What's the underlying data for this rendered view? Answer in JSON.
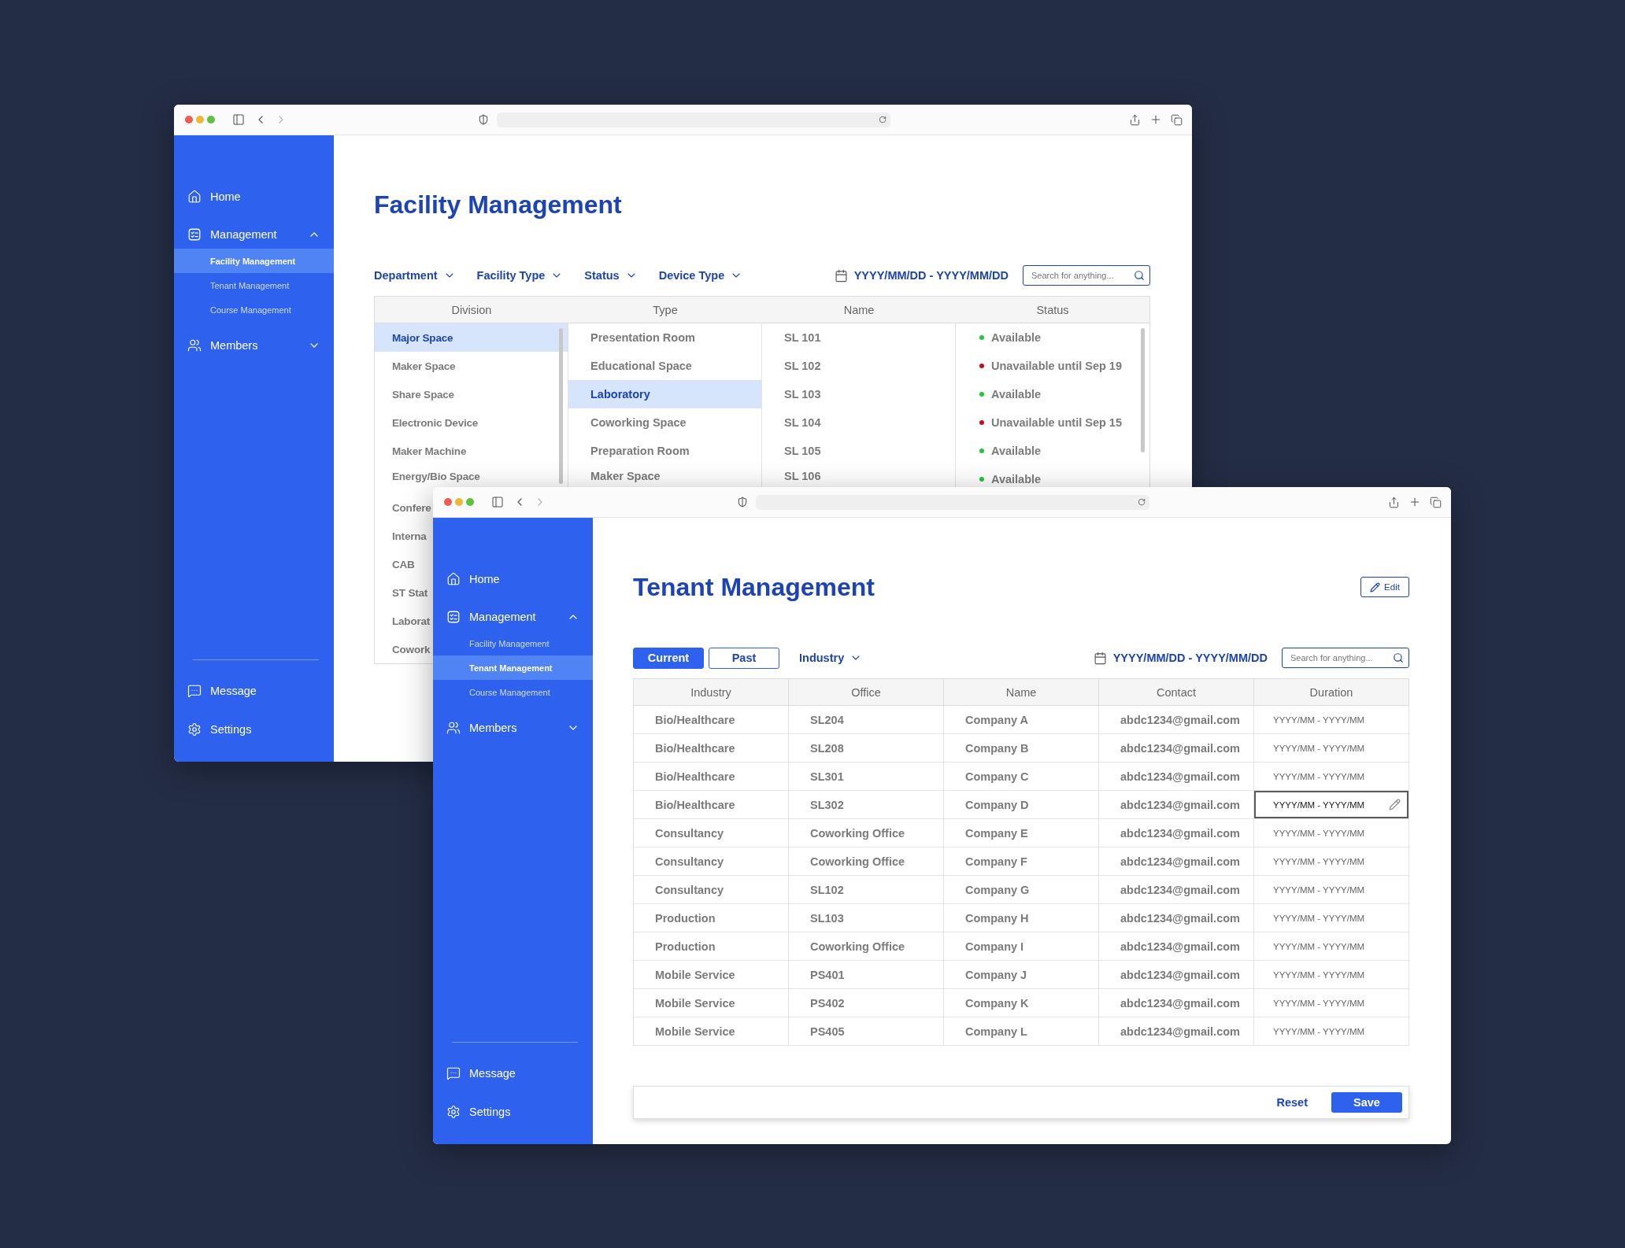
{
  "facility_window": {
    "sidebar": {
      "items": [
        {
          "kind": "home",
          "label": "Home"
        },
        {
          "kind": "management",
          "label": "Management",
          "expanded": true,
          "children": [
            {
              "label": "Facility Management",
              "selected": true
            },
            {
              "label": "Tenant Management",
              "selected": false
            },
            {
              "label": "Course Management",
              "selected": false
            }
          ]
        },
        {
          "kind": "members",
          "label": "Members",
          "expanded": false
        }
      ],
      "bottom_items": [
        {
          "kind": "message",
          "label": "Message"
        },
        {
          "kind": "settings",
          "label": "Settings"
        }
      ]
    },
    "title": "Facility Management",
    "filters": [
      "Department",
      "Facility Type",
      "Status",
      "Device Type"
    ],
    "date_range": "YYYY/MM/DD - YYYY/MM/DD",
    "search": {
      "placeholder": "Search for anything..."
    },
    "table": {
      "columns": [
        "Division",
        "Type",
        "Name",
        "Status"
      ],
      "division": [
        {
          "label": "Major Space",
          "selected": true
        },
        {
          "label": "Maker Space",
          "selected": false
        },
        {
          "label": "Share Space",
          "selected": false
        },
        {
          "label": "Electronic Device",
          "selected": false
        },
        {
          "label": "Maker Machine",
          "selected": false
        },
        {
          "label": "Energy/Bio Space",
          "selected": false
        },
        {
          "label": "Confere",
          "selected": false
        },
        {
          "label": "Interna",
          "selected": false
        },
        {
          "label": "CAB",
          "selected": false
        },
        {
          "label": "ST Stat",
          "selected": false
        },
        {
          "label": "Laborat",
          "selected": false
        },
        {
          "label": "Cowork",
          "selected": false
        }
      ],
      "type": [
        {
          "label": "Presentation Room",
          "selected": false
        },
        {
          "label": "Educational Space",
          "selected": false
        },
        {
          "label": "Laboratory",
          "selected": true
        },
        {
          "label": "Coworking Space",
          "selected": false
        },
        {
          "label": "Preparation Room",
          "selected": false
        },
        {
          "label": "Maker Space",
          "selected": false
        }
      ],
      "name": [
        "SL 101",
        "SL 102",
        "SL 103",
        "SL 104",
        "SL 105",
        "SL 106"
      ],
      "status": [
        {
          "label": "Available",
          "color": "#1fc93a"
        },
        {
          "label": "Unavailable until Sep 19",
          "color": "#c0121a"
        },
        {
          "label": "Available",
          "color": "#1fc93a"
        },
        {
          "label": "Unavailable until Sep 15",
          "color": "#c0121a"
        },
        {
          "label": "Available",
          "color": "#1fc93a"
        },
        {
          "label": "Available",
          "color": "#1fc93a"
        }
      ]
    }
  },
  "tenant_window": {
    "sidebar": {
      "items": [
        {
          "kind": "home",
          "label": "Home"
        },
        {
          "kind": "management",
          "label": "Management",
          "expanded": true,
          "children": [
            {
              "label": "Facility Management",
              "selected": false
            },
            {
              "label": "Tenant Management",
              "selected": true
            },
            {
              "label": "Course Management",
              "selected": false
            }
          ]
        },
        {
          "kind": "members",
          "label": "Members",
          "expanded": false
        }
      ],
      "bottom_items": [
        {
          "kind": "message",
          "label": "Message"
        },
        {
          "kind": "settings",
          "label": "Settings"
        }
      ]
    },
    "title": "Tenant Management",
    "edit_button": "Edit",
    "tabs": [
      {
        "label": "Current",
        "selected": true
      },
      {
        "label": "Past",
        "selected": false
      }
    ],
    "filters": [
      "Industry"
    ],
    "date_range": "YYYY/MM/DD - YYYY/MM/DD",
    "search": {
      "placeholder": "Search for anything..."
    },
    "table": {
      "columns": [
        "Industry",
        "Office",
        "Name",
        "Contact",
        "Duration"
      ],
      "rows": [
        {
          "cells": [
            "Bio/Healthcare",
            "SL204",
            "Company A",
            "abdc1234@gmail.com",
            "YYYY/MM - YYYY/MM"
          ],
          "editing": false
        },
        {
          "cells": [
            "Bio/Healthcare",
            "SL208",
            "Company B",
            "abdc1234@gmail.com",
            "YYYY/MM - YYYY/MM"
          ],
          "editing": false
        },
        {
          "cells": [
            "Bio/Healthcare",
            "SL301",
            "Company C",
            "abdc1234@gmail.com",
            "YYYY/MM - YYYY/MM"
          ],
          "editing": false
        },
        {
          "cells": [
            "Bio/Healthcare",
            "SL302",
            "Company D",
            "abdc1234@gmail.com",
            "YYYY/MM - YYYY/MM"
          ],
          "editing": true
        },
        {
          "cells": [
            "Consultancy",
            "Coworking Office",
            "Company E",
            "abdc1234@gmail.com",
            "YYYY/MM - YYYY/MM"
          ],
          "editing": false
        },
        {
          "cells": [
            "Consultancy",
            "Coworking Office",
            "Company F",
            "abdc1234@gmail.com",
            "YYYY/MM - YYYY/MM"
          ],
          "editing": false
        },
        {
          "cells": [
            "Consultancy",
            "SL102",
            "Company G",
            "abdc1234@gmail.com",
            "YYYY/MM - YYYY/MM"
          ],
          "editing": false
        },
        {
          "cells": [
            "Production",
            "SL103",
            "Company H",
            "abdc1234@gmail.com",
            "YYYY/MM - YYYY/MM"
          ],
          "editing": false
        },
        {
          "cells": [
            "Production",
            "Coworking Office",
            "Company I",
            "abdc1234@gmail.com",
            "YYYY/MM - YYYY/MM"
          ],
          "editing": false
        },
        {
          "cells": [
            "Mobile Service",
            "PS401",
            "Company J",
            "abdc1234@gmail.com",
            "YYYY/MM - YYYY/MM"
          ],
          "editing": false
        },
        {
          "cells": [
            "Mobile Service",
            "PS402",
            "Company K",
            "abdc1234@gmail.com",
            "YYYY/MM - YYYY/MM"
          ],
          "editing": false
        },
        {
          "cells": [
            "Mobile Service",
            "PS405",
            "Company L",
            "abdc1234@gmail.com",
            "YYYY/MM - YYYY/MM"
          ],
          "editing": false
        }
      ]
    },
    "footer": {
      "buttons": [
        {
          "label": "Reset",
          "kind": "text"
        },
        {
          "label": "Save",
          "kind": "primary"
        }
      ]
    }
  }
}
